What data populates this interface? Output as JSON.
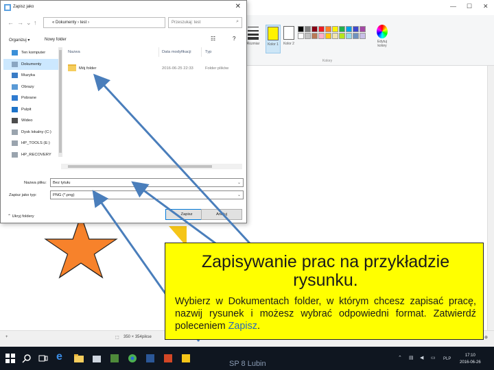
{
  "paint": {
    "tools": [
      "Rozmiar",
      "Kolor 1",
      "Kolor 2"
    ],
    "edit_colors": "Edytuj kolory",
    "colors_group": "Kolory",
    "status_size": "350 × 354pikse",
    "palette": [
      "#000000",
      "#7f7f7f",
      "#880015",
      "#ed1c24",
      "#ff7f27",
      "#fff200",
      "#22b14c",
      "#00a2e8",
      "#3f48cc",
      "#a349a4",
      "#ffffff",
      "#c3c3c3",
      "#b97a57",
      "#ffaec9",
      "#ffc90e",
      "#efe4b0",
      "#b5e61d",
      "#99d9ea",
      "#7092be",
      "#c8bfe7"
    ],
    "color1": "#fff200",
    "color2": "#ffffff"
  },
  "dialog": {
    "title": "Zapisz jako",
    "address": "« Dokumenty › test ›",
    "search_placeholder": "Przeszukaj: test",
    "organize": "Organizuj ▾",
    "new_folder": "Nowy folder",
    "nav": [
      "Ten komputer",
      "Dokumenty",
      "Muzyka",
      "Obrazy",
      "Pobrane",
      "Pulpit",
      "Wideo",
      "Dysk lokalny (C:)",
      "HP_TOOLS (E:)",
      "HP_RECOVERY"
    ],
    "columns": {
      "name": "Nazwa",
      "date": "Data modyfikacji",
      "type": "Typ"
    },
    "files": [
      {
        "name": "Mój folder",
        "date": "2016-06-25 22:33",
        "type": "Folder plików"
      }
    ],
    "filename_label": "Nazwa pliku:",
    "filename_value": "Bez tytułu",
    "filetype_label": "Zapisz jako typ:",
    "filetype_value": "PNG (*.png)",
    "hide_folders": "⌃ Ukryj foldery",
    "save_button": "Zapisz",
    "cancel_button": "Anuluj"
  },
  "caption": {
    "title": "Zapisywanie prac na przykładzie rysunku.",
    "body_main": "Wybierz w Dokumentach folder, w którym chcesz zapisać pracę, nazwij rysunek i możesz wybrać odpowiedni format. Zatwierdź poleceniem ",
    "body_accent": "Zapisz",
    "body_end": "."
  },
  "taskbar": {
    "center_text": "SP 8  Lubin",
    "lang": "PLP",
    "time": "17:10",
    "date": "2016-06-26"
  }
}
